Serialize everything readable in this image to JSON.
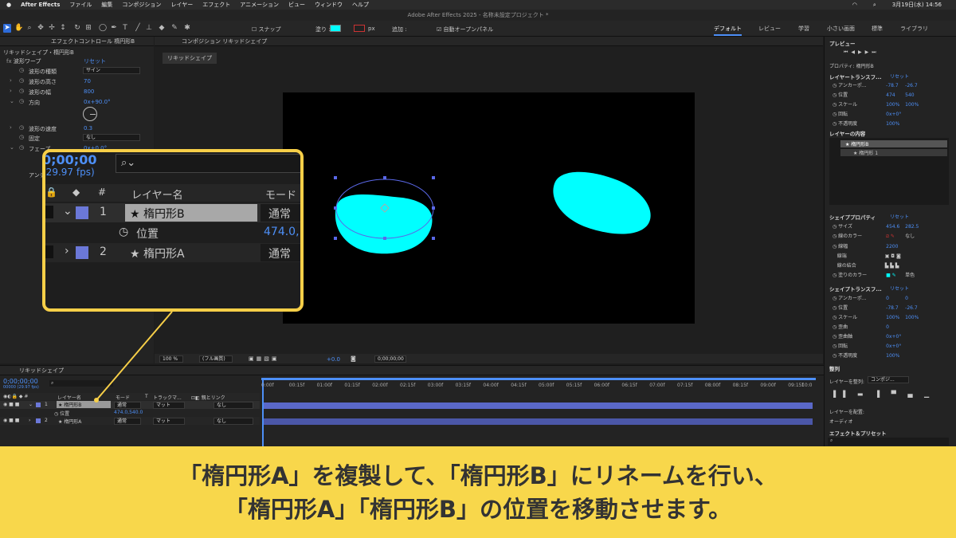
{
  "menubar": {
    "apple": "",
    "app": "After Effects",
    "items": [
      "ファイル",
      "編集",
      "コンポジション",
      "レイヤー",
      "エフェクト",
      "アニメーション",
      "ビュー",
      "ウィンドウ",
      "ヘルプ"
    ],
    "clock": "3月19日(水) 14:56"
  },
  "window_title": "Adobe After Effects 2025 - 名称未設定プロジェクト *",
  "toolbar": {
    "snap": "スナップ",
    "fill": "塗り :",
    "stroke": "px",
    "add": "追加 :",
    "auto_open": "自動オープンパネル",
    "workspaces": [
      "デフォルト",
      "レビュー",
      "学習",
      "小さい画面",
      "標準",
      "ライブラリ"
    ]
  },
  "effects_panel": {
    "tab": "エフェクトコントロール 楕円形B",
    "layer_path": "リキッドシェイプ・楕円形B",
    "effect": "波形ワープ",
    "reset": "リセット",
    "rows": [
      {
        "label": "波形の種類",
        "value": "サイン",
        "dropdown": true
      },
      {
        "label": "波形の高さ",
        "value": "70"
      },
      {
        "label": "波形の幅",
        "value": "800"
      },
      {
        "label": "方向",
        "value": "0x+90.0°"
      },
      {
        "label": "波形の速度",
        "value": "0.3"
      },
      {
        "label": "固定",
        "value": "なし",
        "dropdown": true
      },
      {
        "label": "フェーズ",
        "value": "0x+0.0°"
      },
      {
        "label": "アンチ",
        "value": ""
      }
    ]
  },
  "comp_panel": {
    "tab": "コンポジション リキッドシェイプ",
    "flow_tab": "リキッドシェイプ",
    "zoom": "100 %",
    "quality": "(フル画質)",
    "timecode": "0;00;00;00",
    "exposure": "+0.0"
  },
  "right_panel": {
    "preview": "プレビュー",
    "properties": "プロパティ: 楕円形B",
    "layer_transform": "レイヤートランスフ...",
    "reset": "リセット",
    "lt": [
      {
        "label": "アンカーポ...",
        "v1": "-78.7",
        "v2": "-26.7"
      },
      {
        "label": "位置",
        "v1": "474",
        "v2": "540"
      },
      {
        "label": "スケール",
        "v1": "100%",
        "v2": "100%"
      },
      {
        "label": "回転",
        "v1": "0x+0°",
        "v2": ""
      },
      {
        "label": "不透明度",
        "v1": "100%",
        "v2": ""
      }
    ],
    "layer_contents": "レイヤーの内容",
    "contents": [
      "楕円形B",
      "楕円形 1"
    ],
    "shape_props": "シェイププロパティ",
    "sp": [
      {
        "label": "サイズ",
        "v1": "454.6",
        "v2": "282.5"
      },
      {
        "label": "線のカラー",
        "v1": "",
        "v2": "なし"
      },
      {
        "label": "線幅",
        "v1": "2200",
        "v2": ""
      },
      {
        "label": "線端",
        "v1": "",
        "v2": ""
      },
      {
        "label": "線の結合",
        "v1": "",
        "v2": ""
      },
      {
        "label": "塗りのカラー",
        "v1": "",
        "v2": "単色"
      }
    ],
    "shape_transform": "シェイプトランスフ...",
    "st": [
      {
        "label": "アンカーポ...",
        "v1": "0",
        "v2": "0"
      },
      {
        "label": "位置",
        "v1": "-78.7",
        "v2": "-26.7"
      },
      {
        "label": "スケール",
        "v1": "100%",
        "v2": "100%"
      },
      {
        "label": "歪曲",
        "v1": "0",
        "v2": ""
      },
      {
        "label": "歪曲軸",
        "v1": "0x+0°",
        "v2": ""
      },
      {
        "label": "回転",
        "v1": "0x+0°",
        "v2": ""
      },
      {
        "label": "不透明度",
        "v1": "100%",
        "v2": ""
      }
    ],
    "align": "整列",
    "align_to": "レイヤーを整列:",
    "align_target": "コンポジ...",
    "distribute": "レイヤーを配置:",
    "audio": "オーディオ",
    "effects_presets": "エフェクト＆プリセット"
  },
  "timeline": {
    "tab": "リキッドシェイプ",
    "timecode": "0;00;00;00",
    "fps": "00000 (29.97 fps)",
    "headers": {
      "name": "レイヤー名",
      "mode": "モード",
      "t": "T",
      "track": "トラックマ...",
      "parent": "親とリンク"
    },
    "layers": [
      {
        "num": "1",
        "name": "楕円形B",
        "mode": "通常",
        "track": "マット",
        "parent": "なし",
        "selected": true
      },
      {
        "num": "2",
        "name": "楕円形A",
        "mode": "通常",
        "track": "マット",
        "parent": "なし",
        "selected": false
      }
    ],
    "sub": {
      "label": "位置",
      "value": "474.0,540.0"
    },
    "ticks": [
      "0:00f",
      "00:15f",
      "01:00f",
      "01:15f",
      "02:00f",
      "02:15f",
      "03:00f",
      "03:15f",
      "04:00f",
      "04:15f",
      "05:00f",
      "05:15f",
      "06:00f",
      "06:15f",
      "07:00f",
      "07:15f",
      "08:00f",
      "08:15f",
      "09:00f",
      "09:15f",
      "10:0"
    ]
  },
  "zoom": {
    "timecode": "0;00;00",
    "fps": "(29.97 fps)",
    "col_hash": "#",
    "col_name": "レイヤー名",
    "col_mode": "モード",
    "layers": [
      {
        "num": "1",
        "name": "楕円形B",
        "mode": "通常"
      },
      {
        "num": "2",
        "name": "楕円形A",
        "mode": "通常"
      }
    ],
    "sub_label": "位置",
    "sub_value": "474.0,"
  },
  "caption": [
    "「楕円形A」を複製して、「楕円形B」にリネームを行い、",
    "「楕円形A」「楕円形B」の位置を移動させます。"
  ],
  "colors": {
    "shape": "#00ffff",
    "accent": "#4d8ff7",
    "label": "#6b78d8",
    "callout": "#f7cf48"
  }
}
